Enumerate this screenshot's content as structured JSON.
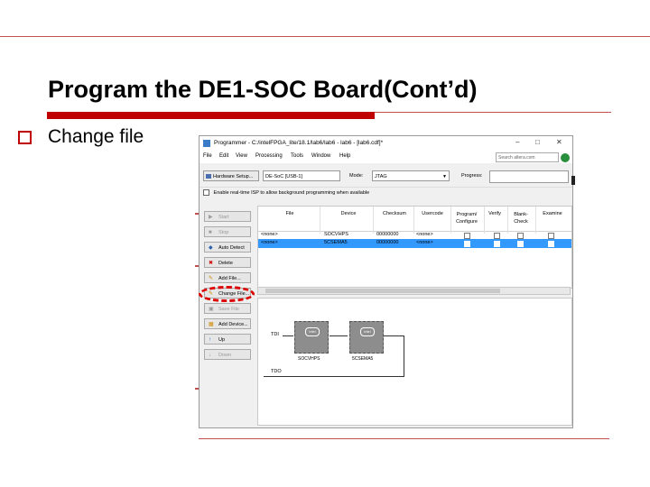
{
  "slide": {
    "title": "Program the DE1-SOC Board(Cont’d)",
    "bullet": "Change file"
  },
  "colors": {
    "accent": "#c00000",
    "rule": "#c0504d",
    "selection": "#3399ff"
  },
  "programmer": {
    "window_title": "Programmer - C:/intelFPGA_lite/18.1/lab6/lab6 - lab6 - [lab6.cdf]*",
    "menu": [
      "File",
      "Edit",
      "View",
      "Processing",
      "Tools",
      "Window",
      "Help"
    ],
    "search_placeholder": "Search altera.com",
    "hardware_setup_label": "Hardware Setup...",
    "hardware_value": "DE-SoC [USB-1]",
    "mode_label": "Mode:",
    "mode_value": "JTAG",
    "progress_label": "Progress:",
    "realtime_isp_label": "Enable real-time ISP to allow background programming when available",
    "buttons": {
      "start": "Start",
      "stop": "Stop",
      "auto_detect": "Auto Detect",
      "delete": "Delete",
      "add_file": "Add File...",
      "change_file": "Change File...",
      "save_file": "Save File",
      "add_device": "Add Device...",
      "up": "Up",
      "down": "Down"
    },
    "columns": [
      "File",
      "Device",
      "Checksum",
      "Usercode",
      "Program/ Configure",
      "Verify",
      "Blank- Check",
      "Examine"
    ],
    "rows": [
      {
        "file": "<none>",
        "device": "SOCVHPS",
        "checksum": "00000000",
        "usercode": "<none>"
      },
      {
        "file": "<none>",
        "device": "5CSEMA5",
        "checksum": "00000000",
        "usercode": "<none>"
      }
    ],
    "diagram": {
      "tdi": "TDI",
      "tdo": "TDO",
      "chips": [
        "SOCVHPS",
        "5CSEMA5"
      ],
      "logo": "intel"
    }
  }
}
